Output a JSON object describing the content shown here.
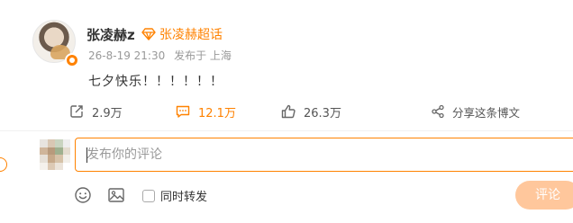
{
  "post": {
    "author": "张凌赫z",
    "super_topic": "张凌赫超话",
    "timestamp": "26-8-19 21:30",
    "source": "发布于 上海",
    "text": "七夕快乐！！！！！！"
  },
  "actions": {
    "forward_count": "2.9万",
    "comment_count": "12.1万",
    "like_count": "26.3万",
    "share_label": "分享这条博文"
  },
  "comment": {
    "placeholder": "发布你的评论",
    "repost_label": "同时转发",
    "submit_label": "评论"
  },
  "icons": {
    "forward": "forward-icon",
    "comment": "comment-icon",
    "like": "like-icon",
    "share": "share-icon",
    "emoji": "emoji-icon",
    "image": "image-icon",
    "super_topic": "diamond-icon",
    "verified": "verified-badge-icon"
  },
  "colors": {
    "accent": "#ff8200",
    "submit_disabled": "#ffc79c",
    "muted_text": "#999999"
  }
}
